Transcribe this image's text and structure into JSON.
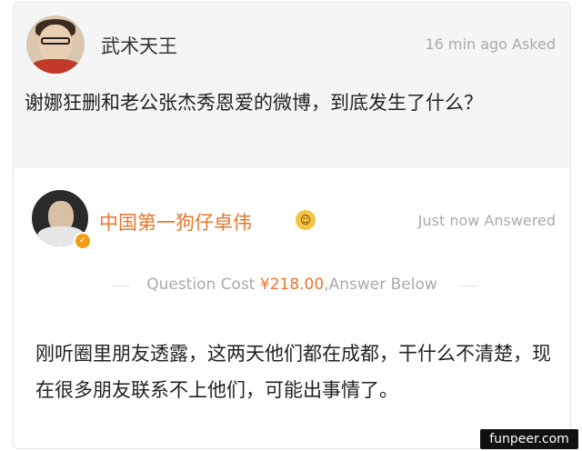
{
  "question": {
    "author": "武术天王",
    "meta": "16 min ago Asked",
    "text": "谢娜狂删和老公张杰秀恩爱的微博，到底发生了什么？"
  },
  "answer": {
    "author": "中国第一狗仔卓伟",
    "meta": "Just now Answered",
    "cost_prefix": "Question Cost ",
    "cost_price": "¥218.00",
    "cost_suffix": ",Answer Below",
    "text": "刚听圈里朋友透露，这两天他们都在成都，干什么不清楚，现在很多朋友联系不上他们，可能出事情了。"
  },
  "watermark": "funpeer.com",
  "colors": {
    "accent": "#e8762c",
    "muted": "#aaaaaa",
    "question_bg": "#f5f5f5"
  },
  "icons": {
    "verified_badge": "verified-badge-icon",
    "emoji": "laughing-emoji-icon"
  }
}
